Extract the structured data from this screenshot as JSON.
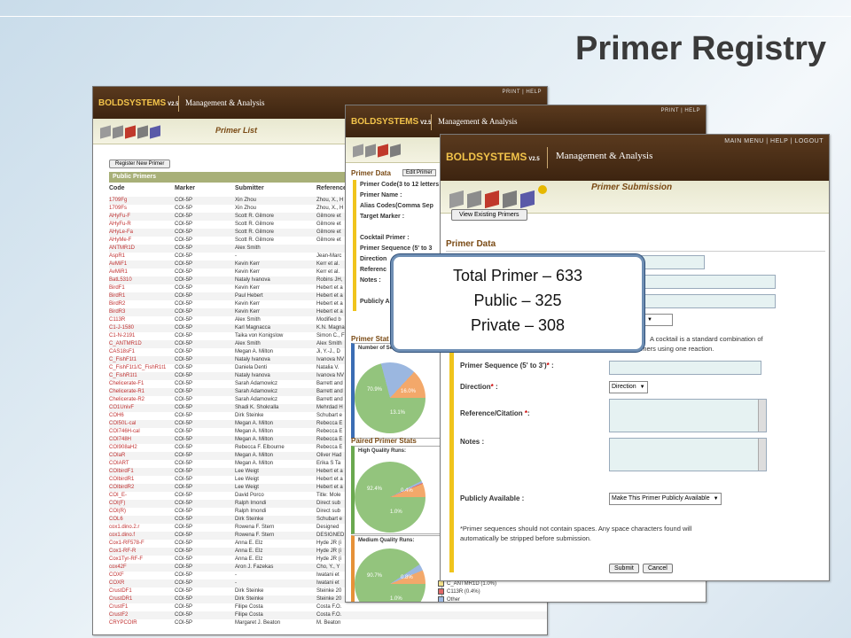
{
  "slide": {
    "title": "Primer Registry"
  },
  "header": {
    "logo": "BOLDSYSTEMS",
    "version": "V2.5",
    "subtitle": "Management & Analysis",
    "nav_short": "PRINT  |  HELP",
    "nav_long": "MAIN MENU   |   HELP   |   LOGOUT"
  },
  "list_window": {
    "page_title": "Primer List",
    "register_button": "Register New Primer",
    "section_label": "Public Primers",
    "columns": [
      "Code",
      "Marker",
      "Submitter",
      "Reference"
    ],
    "rows": [
      [
        "1709Fg",
        "COI-5P",
        "Xin Zhou",
        "Zhou, X., H"
      ],
      [
        "1709Fs",
        "COI-5P",
        "Xin Zhou",
        "Zhou, X., H"
      ],
      [
        "AHyFu-F",
        "COI-5P",
        "Scott R. Gilmore",
        "Gilmore et"
      ],
      [
        "AHyFu-R",
        "COI-5P",
        "Scott R. Gilmore",
        "Gilmore et"
      ],
      [
        "AHyLe-Fa",
        "COI-5P",
        "Scott R. Gilmore",
        "Gilmore et"
      ],
      [
        "AHyMe-F",
        "COI-5P",
        "Scott R. Gilmore",
        "Gilmore et"
      ],
      [
        "ANTMR1D",
        "COI-5P",
        "Alex Smith",
        ""
      ],
      [
        "AspR1",
        "COI-5P",
        "-",
        "Jean-Marc"
      ],
      [
        "AvMiF1",
        "COI-5P",
        "Kevin Kerr",
        "Kerr et al."
      ],
      [
        "AvMiR1",
        "COI-5P",
        "Kevin Kerr",
        "Kerr et al."
      ],
      [
        "BatL5310",
        "COI-5P",
        "Nataly Ivanova",
        "Robins JH,"
      ],
      [
        "BirdF1",
        "COI-5P",
        "Kevin Kerr",
        "Hebert et a"
      ],
      [
        "BirdR1",
        "COI-5P",
        "Paul Hebert",
        "Hebert et a"
      ],
      [
        "BirdR2",
        "COI-5P",
        "Kevin Kerr",
        "Hebert et a"
      ],
      [
        "BirdR3",
        "COI-5P",
        "Kevin Kerr",
        "Hebert et a"
      ],
      [
        "C113R",
        "COI-5P",
        "Alex Smith",
        "Modified b"
      ],
      [
        "C1-J-1580",
        "COI-5P",
        "Karl Magnacca",
        "K.N. Magna"
      ],
      [
        "C1-N-2191",
        "COI-5P",
        "Taika von Konigslow",
        "Simon C., F"
      ],
      [
        "C_ANTMR1D",
        "COI-5P",
        "Alex Smith",
        "Alex Smith"
      ],
      [
        "CAS18sF1",
        "COI-5P",
        "Megan A. Milton",
        "Ji, Y.-J., D"
      ],
      [
        "C_FishF1t1",
        "COI-5P",
        "Nataly Ivanova",
        "Ivanova NV"
      ],
      [
        "C_FishF1t1/C_FishR1t1",
        "COI-5P",
        "Daniela Denti",
        "Natalia V."
      ],
      [
        "C_FishR1t1",
        "COI-5P",
        "Nataly Ivanova",
        "Ivanova NV"
      ],
      [
        "Chelicerate-F1",
        "COI-5P",
        "Sarah Adamowicz",
        "Barrett and"
      ],
      [
        "Chelicerate-R1",
        "COI-5P",
        "Sarah Adamowicz",
        "Barrett and"
      ],
      [
        "Chelicerate-R2",
        "COI-5P",
        "Sarah Adamowicz",
        "Barrett and"
      ],
      [
        "CO1UnivF",
        "COI-5P",
        "Shadi K. Shokralla",
        "Mehrdad H"
      ],
      [
        "COH6",
        "COI-5P",
        "Dirk Steinke",
        "Schubart e"
      ],
      [
        "COI50L-cal",
        "COI-5P",
        "Megan A. Milton",
        "Rebecca E"
      ],
      [
        "COI746H-cal",
        "COI-5P",
        "Megan A. Milton",
        "Rebecca E"
      ],
      [
        "COI748H",
        "COI-5P",
        "Megan A. Milton",
        "Rebecca E"
      ],
      [
        "COI908aH2",
        "COI-5P",
        "Rebecca F. Elbourne",
        "Rebecca E"
      ],
      [
        "COIaR",
        "COI-5P",
        "Megan A. Milton",
        "Oliver Had"
      ],
      [
        "COIART",
        "COI-5P",
        "Megan A. Milton",
        "Erika S Ta"
      ],
      [
        "COIbirdF1",
        "COI-5P",
        "Lee Weigt",
        "Hebert et a"
      ],
      [
        "COIbirdR1",
        "COI-5P",
        "Lee Weigt",
        "Hebert et a"
      ],
      [
        "COIbirdR2",
        "COI-5P",
        "Lee Weigt",
        "Hebert et a"
      ],
      [
        "COI_E-",
        "COI-5P",
        "David Porco",
        "Title: Mole"
      ],
      [
        "COI(F)",
        "COI-5P",
        "Ralph Imondi",
        "Direct sub"
      ],
      [
        "COI(R)",
        "COI-5P",
        "Ralph Imondi",
        "Direct sub"
      ],
      [
        "COL6",
        "COI-5P",
        "Dirk Steinke",
        "Schubart e"
      ],
      [
        "cox1.dino.2.r",
        "COI-5P",
        "Rowena F. Stern",
        "Designed"
      ],
      [
        "cox1.dino.f",
        "COI-5P",
        "Rowena F. Stern",
        "DESIGNED"
      ],
      [
        "Cox1-RF578-F",
        "COI-5P",
        "Anna E. Elz",
        "Hyde JR (i"
      ],
      [
        "Cox1-RF-R",
        "COI-5P",
        "Anna E. Elz",
        "Hyde JR (i"
      ],
      [
        "Cox1Tyr-RF-F",
        "COI-5P",
        "Anna E. Elz",
        "Hyde JR (i"
      ],
      [
        "cox42F",
        "COI-5P",
        "Aron J. Fazekas",
        "Cho, Y., Y"
      ],
      [
        "COXF",
        "COI-5P",
        "-",
        "Iwatani et"
      ],
      [
        "COXR",
        "COI-5P",
        "-",
        "Iwatani et"
      ],
      [
        "CrustDF1",
        "COI-5P",
        "Dirk Steinke",
        "Steinke 20"
      ],
      [
        "CrustDR1",
        "COI-5P",
        "Dirk Steinke",
        "Steinke 20"
      ],
      [
        "CrustF1",
        "COI-5P",
        "Filipe Costa",
        "Costa F.O."
      ],
      [
        "CrustF2",
        "COI-5P",
        "Filipe Costa",
        "Costa F.O."
      ],
      [
        "CRYPCOIR",
        "COI-5P",
        "Margaret J. Beaton",
        "M. Beaton"
      ]
    ]
  },
  "data_window": {
    "section": "Primer Data",
    "edit_button": "Edit Primer",
    "fields": [
      "Primer Code(3 to 12 letters",
      "Primer Name :",
      "Alias Codes(Comma Sep",
      "Target Marker :",
      "",
      "Cocktail Primer :",
      "Primer Sequence (5' to 3",
      "Direction",
      "Referenc",
      "Notes :",
      "",
      "Publicly A"
    ],
    "stats_title": "Primer Stat",
    "stats_box_label": "Number of Sequencing Ru",
    "paired_title": "Paired Primer Stats",
    "high_label": "High Quality Runs:",
    "medium_label": "Medium Quality Runs:",
    "pie1": {
      "slices": [
        70.9,
        16.0,
        13.1
      ],
      "labels": [
        "70.9%",
        "16.0%",
        "13.1%"
      ],
      "colors": [
        "#93c47d",
        "#9bb7e0",
        "#f3a86a"
      ]
    },
    "pie2": {
      "slices": [
        92.4,
        1.0,
        0.4,
        6.2
      ],
      "labels": [
        "92.4%",
        "0.4%",
        "1.0%"
      ],
      "colors": [
        "#93c47d",
        "#9bb7e0",
        "#e06666",
        "#f3a86a"
      ]
    },
    "pie3": {
      "slices": [
        90.7,
        3.0,
        6.3
      ],
      "labels": [
        "90.7%",
        "0.8%",
        "1.0%"
      ],
      "colors": [
        "#93c47d",
        "#9bb7e0",
        "#f3a86a"
      ]
    },
    "legend": [
      {
        "label": "C_ANTMR1D (1.0%)",
        "color": "#f3e08a"
      },
      {
        "label": "C113R (0.4%)",
        "color": "#e06666"
      },
      {
        "label": "Other",
        "color": "#9bb7e0"
      }
    ]
  },
  "submission_window": {
    "page_title": "Primer Submission",
    "view_button": "View Existing Primers",
    "section": "Primer Data",
    "cocktail_text_1": "A cocktail is a standard combination of",
    "cocktail_text_2": "multiple primers using one reaction.",
    "sequence_label": "Primer Sequence (5' to 3')",
    "direction_label": "Direction",
    "direction_value": "Direction",
    "reference_label": "Reference/Citation",
    "notes_label": "Notes :",
    "public_label": "Publicly Available :",
    "public_value": "Make This Primer Publicly Available",
    "note_1": "*Primer sequences should not contain spaces. Any space characters found  will",
    "note_2": "automatically be stripped before submission.",
    "submit_button": "Submit",
    "cancel_button": "Cancel",
    "required_mark": "*",
    "colon": ":"
  },
  "callout": {
    "total": "Total Primer – 633",
    "public": "Public – 325",
    "private": "Private – 308"
  }
}
